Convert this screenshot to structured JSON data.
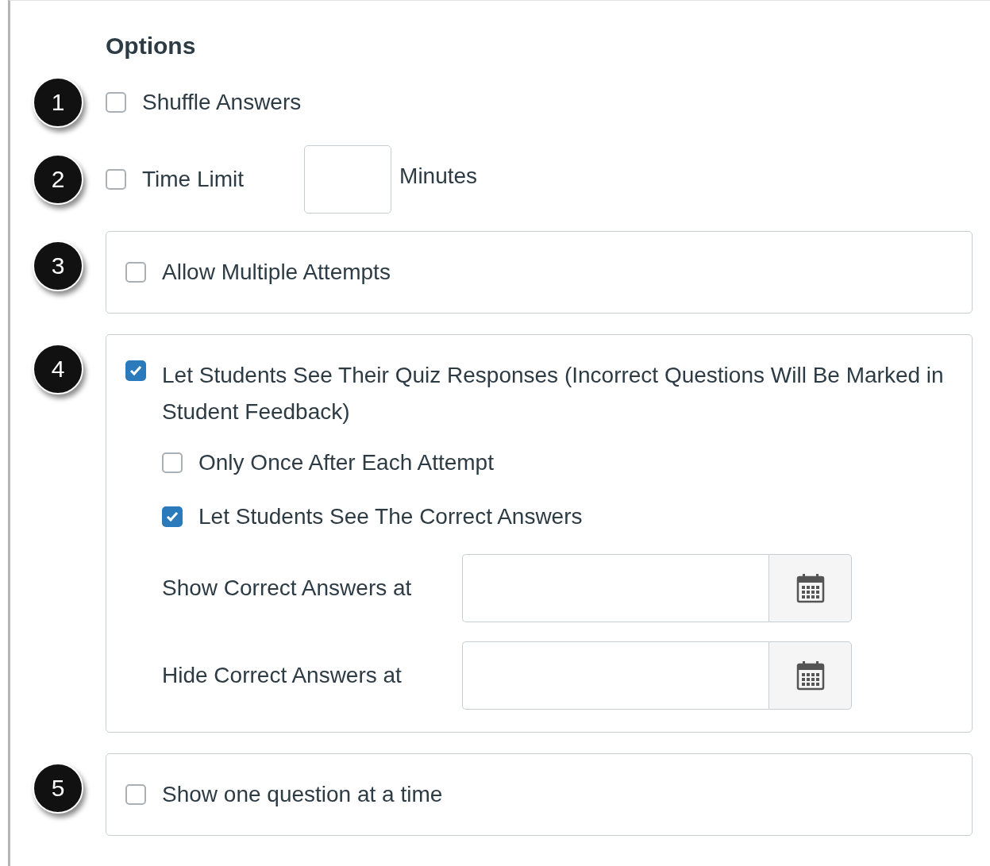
{
  "heading": "Options",
  "options": [
    {
      "badge": "1",
      "kind": "plain",
      "label": "Shuffle Answers",
      "checked": false
    },
    {
      "badge": "2",
      "kind": "time_limit",
      "label": "Time Limit",
      "checked": false,
      "unit": "Minutes"
    },
    {
      "badge": "3",
      "kind": "boxed",
      "label": "Allow Multiple Attempts",
      "checked": false
    },
    {
      "badge": "4",
      "kind": "responses",
      "label": "Let Students See Their Quiz Responses (Incorrect Questions Will Be Marked in Student Feedback)",
      "checked": true,
      "sub_options": [
        {
          "label": "Only Once After Each Attempt",
          "checked": false
        },
        {
          "label": "Let Students See The Correct Answers",
          "checked": true
        }
      ],
      "date_fields": [
        {
          "label": "Show Correct Answers at"
        },
        {
          "label": "Hide Correct Answers at"
        }
      ]
    },
    {
      "badge": "5",
      "kind": "boxed",
      "label": "Show one question at a time",
      "checked": false
    }
  ]
}
